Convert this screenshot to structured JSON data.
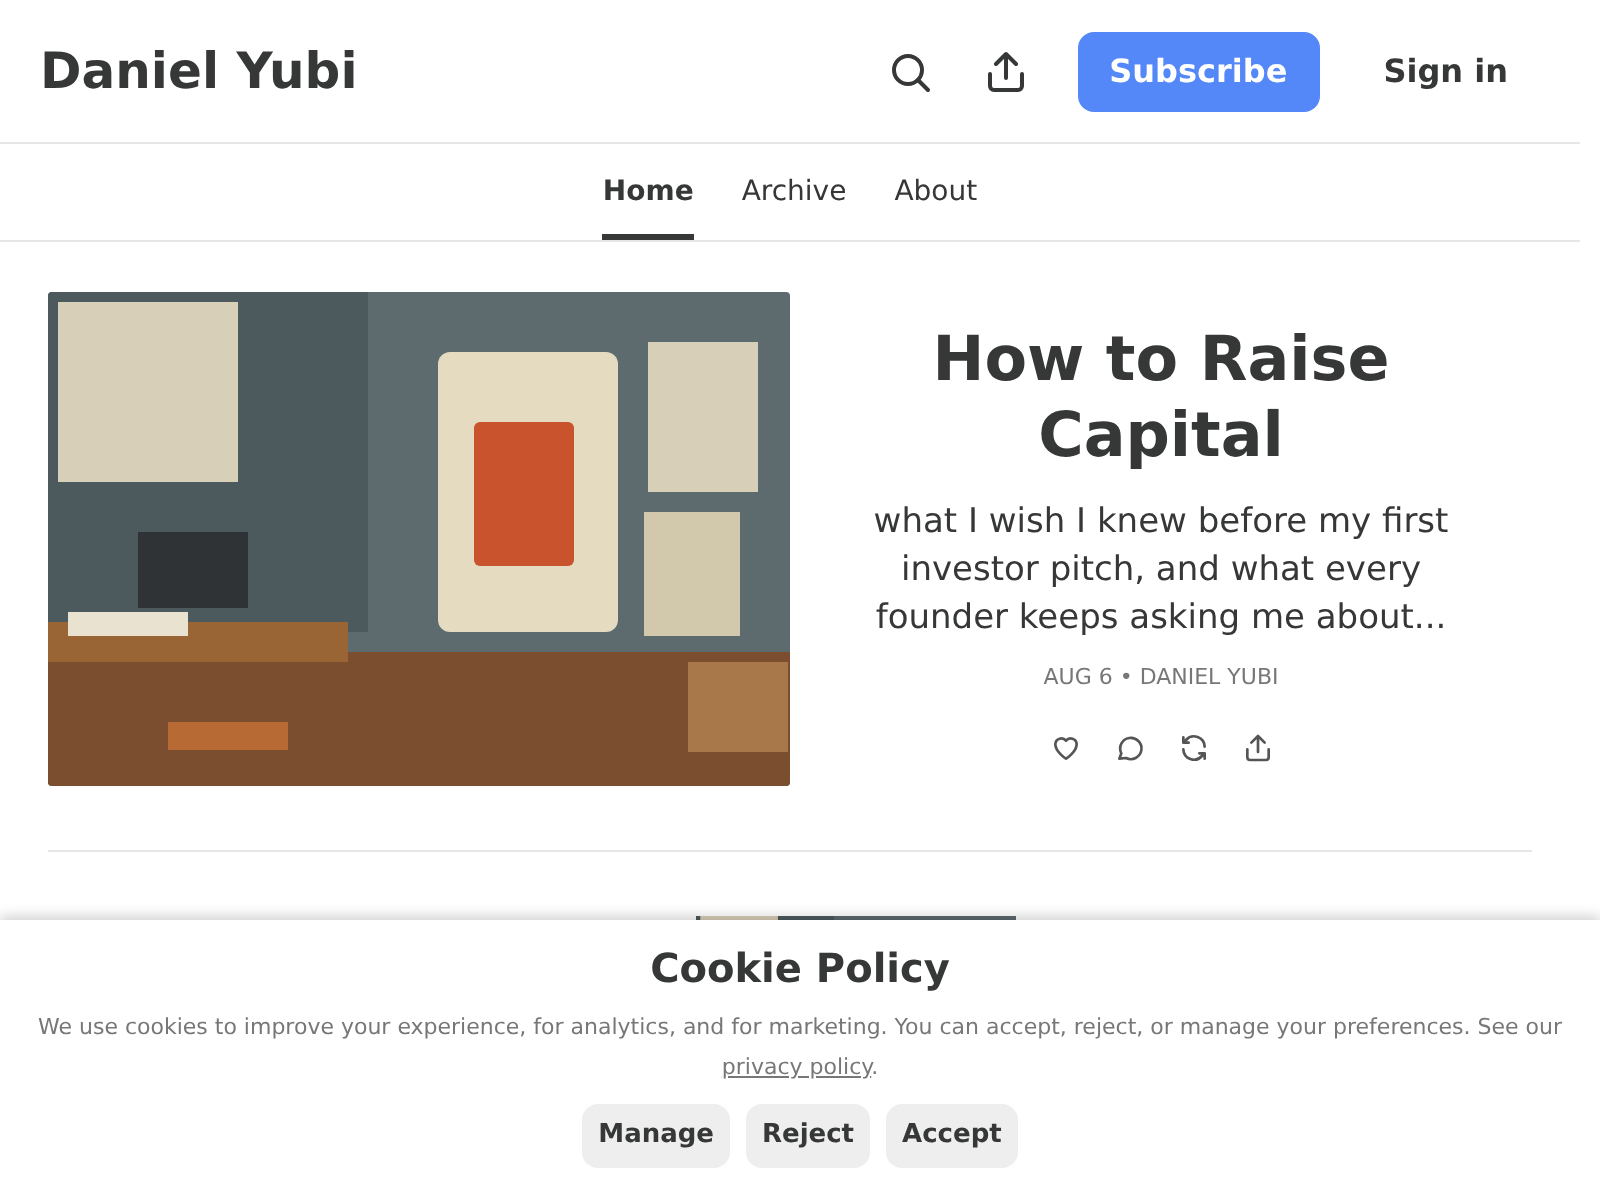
{
  "header": {
    "title": "Daniel Yubi",
    "subscribe": "Subscribe",
    "sign_in": "Sign in"
  },
  "tabs": [
    {
      "label": "Home",
      "selected": true
    },
    {
      "label": "Archive",
      "selected": false
    },
    {
      "label": "About",
      "selected": false
    }
  ],
  "featured": {
    "title": "How to Raise Capital",
    "subtitle": "what I wish I knew before my first investor pitch, and what every founder keeps asking me about...",
    "meta": "AUG 6 • DANIEL YUBI"
  },
  "cookie": {
    "title": "Cookie Policy",
    "text": "We use cookies to improve your experience, for analytics, and for marketing. You can accept, reject, or manage your preferences. See our",
    "link": "privacy policy",
    "after": ".",
    "buttons": [
      "Manage",
      "Reject",
      "Accept"
    ]
  }
}
